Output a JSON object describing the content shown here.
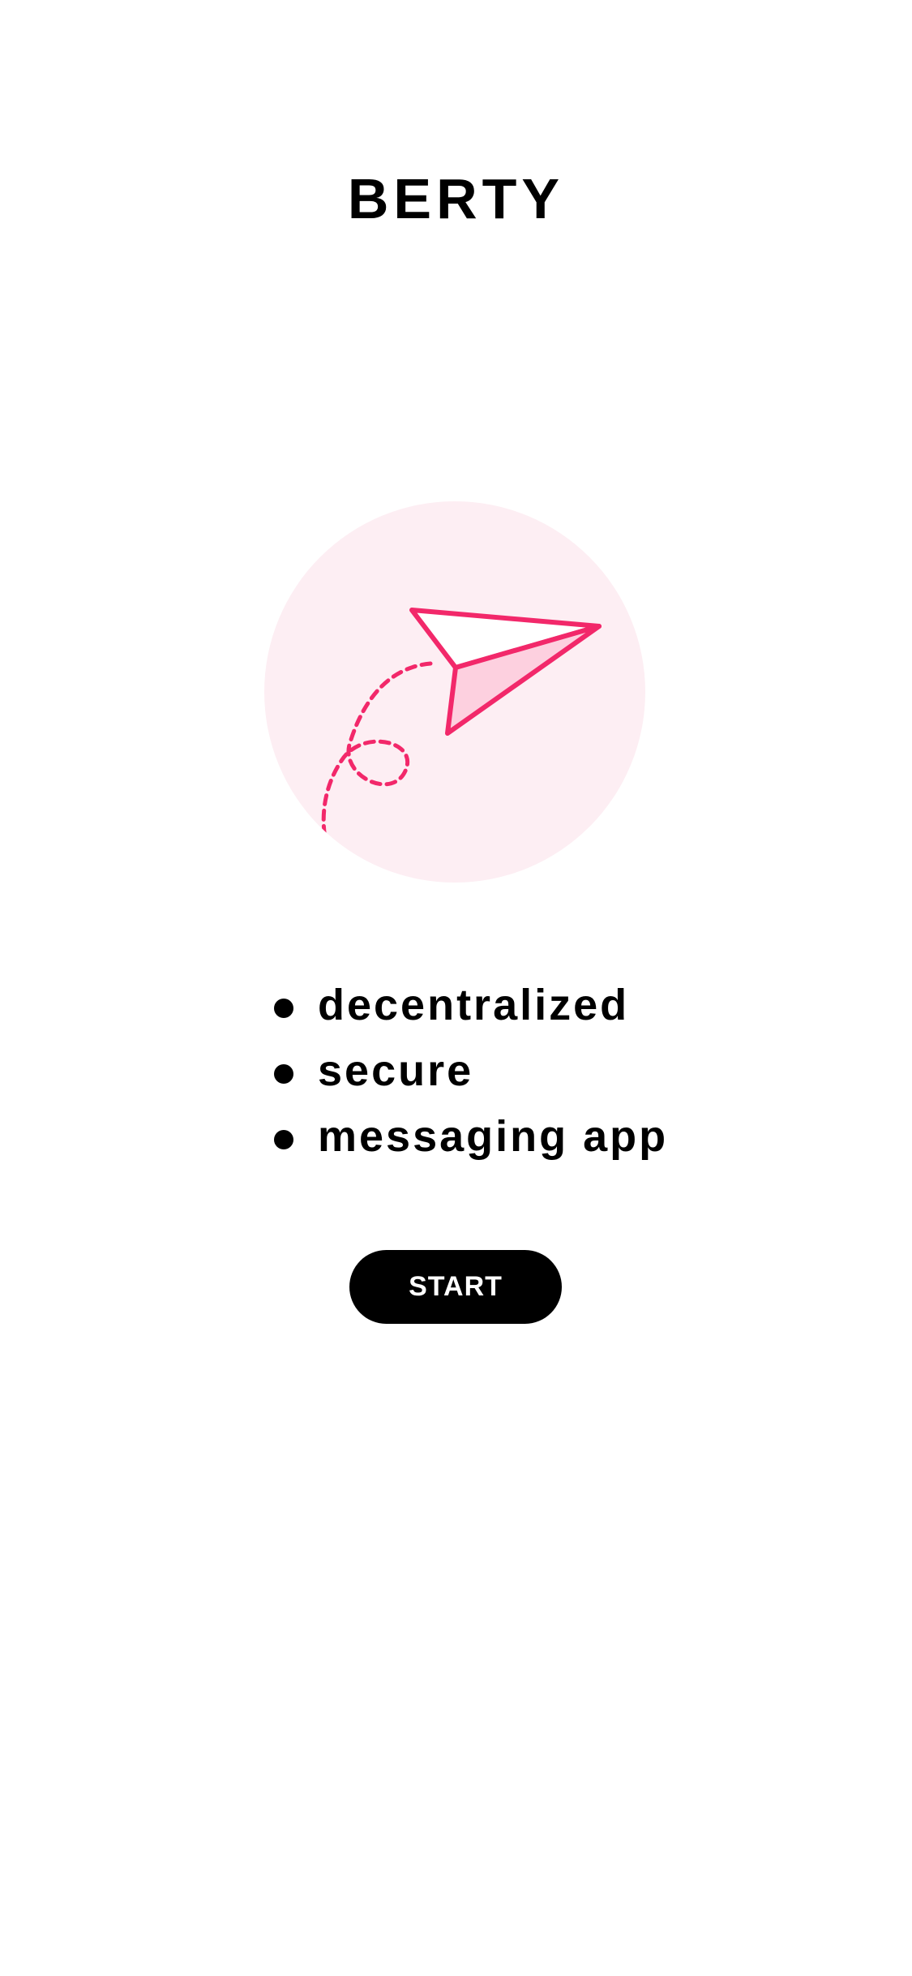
{
  "app": {
    "title": "BERTY"
  },
  "illustration": {
    "icon": "paper-plane-icon",
    "circle_color": "#fdeef3",
    "stroke_color": "#f2286a",
    "fill_color": "#fdd0df"
  },
  "taglines": [
    "decentralized",
    "secure",
    "messaging app"
  ],
  "start_button": {
    "label": "START"
  }
}
